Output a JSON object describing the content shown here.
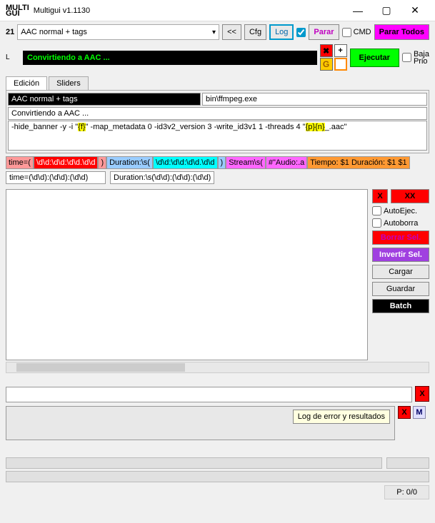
{
  "window": {
    "logo1": "MULTI",
    "logo2": "GUI",
    "title": "Multigui v1.1130"
  },
  "top": {
    "count": "21",
    "preset": "AAC normal + tags",
    "back": "<<",
    "cfg": "Cfg",
    "log": "Log",
    "parar": "Parar",
    "cmd": "CMD",
    "parar_todos": "Parar Todos",
    "l": "L",
    "status": "Convirtiendo a AAC ...",
    "plus": "+",
    "g": "G",
    "ejecutar": "Ejecutar",
    "baja1": "Baja",
    "baja2": "Prio"
  },
  "tabs": {
    "edicion": "Edición",
    "sliders": "Sliders"
  },
  "fields": {
    "preset_name": "AAC normal + tags",
    "exe": "bin\\ffmpeg.exe",
    "statusline": "Convirtiendo a AAC ...",
    "cmd_pre": "-hide_banner -y -i \"",
    "cmd_hl1": "{f}",
    "cmd_mid": "\" -map_metadata 0 -id3v2_version 3 -write_id3v1 1 -threads 4 \"",
    "cmd_hl2": "{p}{n}",
    "cmd_post": "_.aac\""
  },
  "regex": {
    "time_lbl": "time=(",
    "time_pat": "\\d\\d:\\d\\d:\\d\\d.\\d\\d",
    "time_end": ")",
    "dur_lbl": "Duration:\\s(",
    "dur_pat": "\\d\\d:\\d\\d:\\d\\d.\\d\\d",
    "dur_end": ")",
    "stream": "Stream\\s(",
    "stream_pat": "#\"Audio:.a",
    "tiempo": "Tiempo: ",
    "t1": "$1",
    "duracion": " Duración: ",
    "d1": "$1",
    "d2": "$1",
    "time2": "time=(\\d\\d):(\\d\\d):(\\d\\d)",
    "dur2": "Duration:\\s(\\d\\d):(\\d\\d):(\\d\\d)"
  },
  "side": {
    "x": "X",
    "xx": "XX",
    "autoejec": "AutoEjec.",
    "autoborra": "Autoborra",
    "borrar": "Borrar Sel.",
    "invertir": "Invertir Sel.",
    "cargar": "Cargar",
    "guardar": "Guardar",
    "batch": "Batch"
  },
  "bottom": {
    "x": "X",
    "tooltip": "Log de error y resultados",
    "m": "M",
    "pcount": "P: 0/0"
  }
}
